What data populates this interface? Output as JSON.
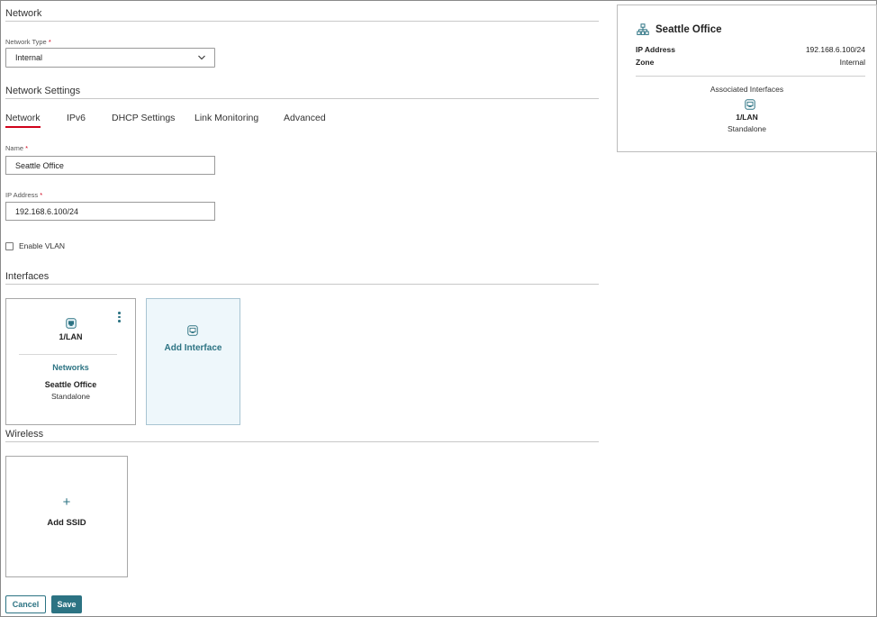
{
  "network_section": {
    "title": "Network",
    "network_type_label": "Network Type",
    "required_mark": "*",
    "network_type_value": "Internal"
  },
  "settings_section": {
    "title": "Network Settings",
    "tabs": [
      {
        "label": "Network",
        "active": true
      },
      {
        "label": "IPv6",
        "active": false
      },
      {
        "label": "DHCP Settings",
        "active": false
      },
      {
        "label": "Link Monitoring",
        "active": false
      },
      {
        "label": "Advanced",
        "active": false
      }
    ],
    "name_label": "Name",
    "name_value": "Seattle Office",
    "ip_label": "IP Address",
    "ip_value": "192.168.6.100/24",
    "vlan_label": "Enable VLAN",
    "vlan_checked": false
  },
  "interfaces_section": {
    "title": "Interfaces",
    "interface_card": {
      "name": "1/LAN",
      "networks_heading": "Networks",
      "network_name": "Seattle Office",
      "network_mode": "Standalone"
    },
    "add_interface_label": "Add Interface"
  },
  "wireless_section": {
    "title": "Wireless",
    "add_ssid_symbol": "+",
    "add_ssid_label": "Add SSID"
  },
  "actions": {
    "cancel_label": "Cancel",
    "save_label": "Save"
  },
  "summary_panel": {
    "title": "Seattle Office",
    "ip_label": "IP Address",
    "ip_value": "192.168.6.100/24",
    "zone_label": "Zone",
    "zone_value": "Internal",
    "associated_heading": "Associated Interfaces",
    "interface_name": "1/LAN",
    "interface_mode": "Standalone"
  },
  "colors": {
    "accent": "#2c7383",
    "tab_underline": "#d0021b",
    "add_card_bg": "#eef7fb"
  },
  "icons": {
    "interface": "ethernet-port-icon",
    "network": "network-tree-icon",
    "dropdown": "chevron-down-icon",
    "menu": "kebab-menu-icon"
  }
}
